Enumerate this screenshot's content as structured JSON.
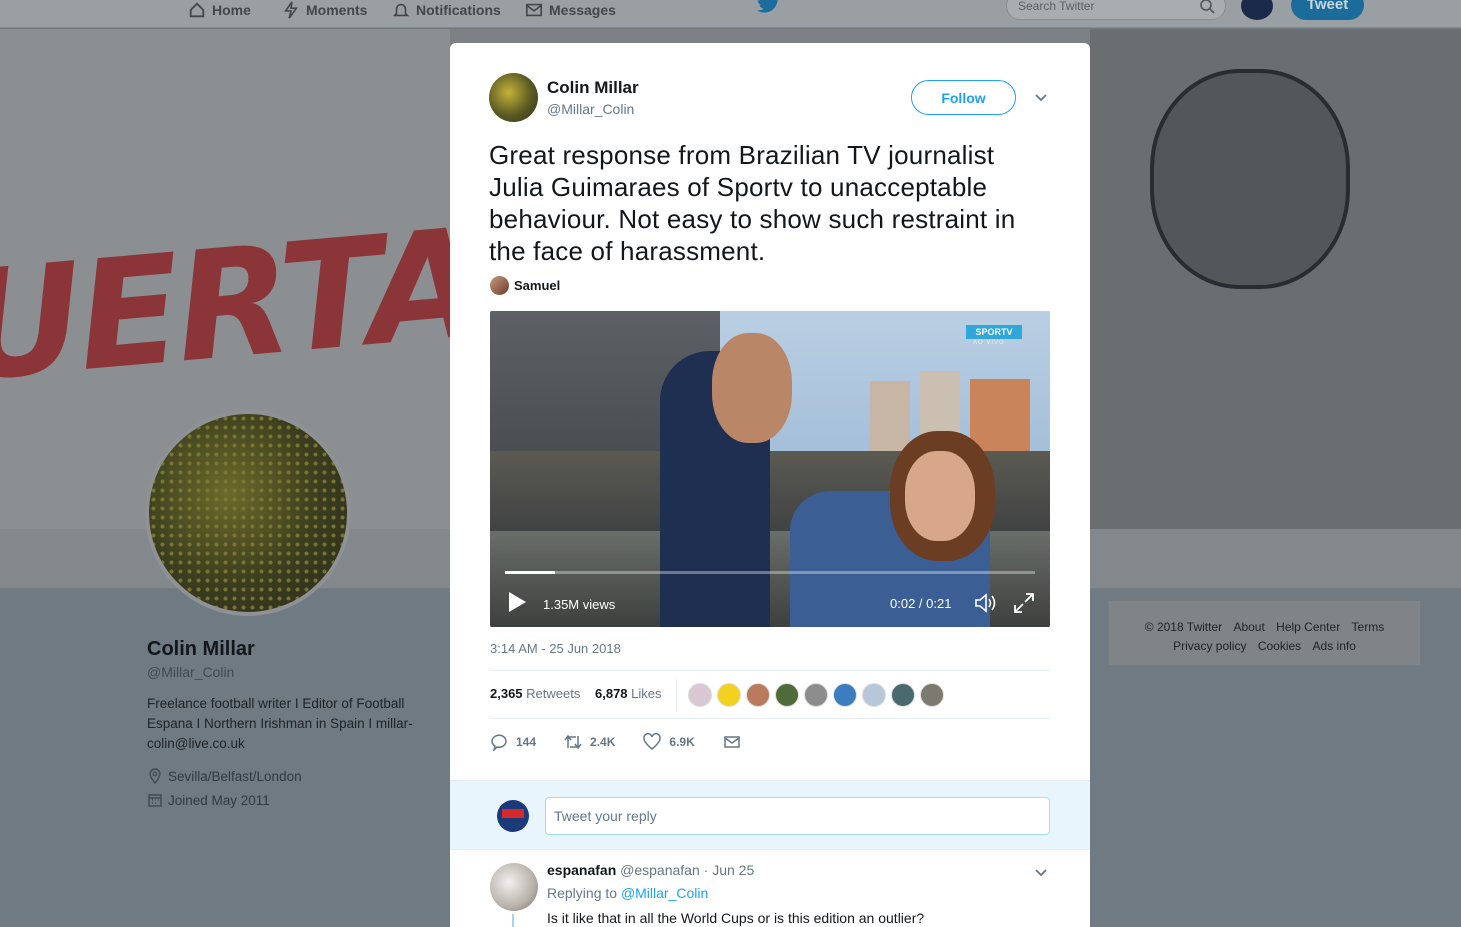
{
  "nav": {
    "items": [
      "Home",
      "Moments",
      "Notifications",
      "Messages"
    ],
    "search_placeholder": "Search Twitter",
    "tweet_button": "Tweet"
  },
  "profile": {
    "name": "Colin Millar",
    "handle": "@Millar_Colin",
    "bio": "Freelance football writer I Editor of Football Espana I Northern Irishman in Spain I millar-colin@live.co.uk",
    "location": "Sevilla/Belfast/London",
    "joined": "Joined May 2011"
  },
  "banner": {
    "text": "UERTA"
  },
  "footer": {
    "row1": [
      "© 2018 Twitter",
      "About",
      "Help Center",
      "Terms"
    ],
    "row2": [
      "Privacy policy",
      "Cookies",
      "Ads info"
    ]
  },
  "tweet": {
    "author_name": "Colin Millar",
    "author_handle": "@Millar_Colin",
    "follow_label": "Follow",
    "text": "Great response from Brazilian TV journalist Julia Guimaraes of Sportv to unacceptable behaviour. Not easy to show such restraint in the face of harassment.",
    "via": "Samuel",
    "video": {
      "views": "1.35M views",
      "time": "0:02 / 0:21",
      "progress": 0.095,
      "channel_logo": "SPORTV",
      "channel_sub": "AO VIVO"
    },
    "timestamp": "3:14 AM - 25 Jun 2018",
    "retweets_count": "2,365",
    "retweets_label": "Retweets",
    "likes_count": "6,878",
    "likes_label": "Likes",
    "liker_colors": [
      "#d9c7d6",
      "#f2d21f",
      "#b97a5e",
      "#4f6b3a",
      "#8d8d8d",
      "#3c7dbf",
      "#b7c7d9",
      "#4a6b6e",
      "#7c7a6e"
    ],
    "actions": {
      "reply_count": "144",
      "retweet_count": "2.4K",
      "like_count": "6.9K"
    },
    "reply_placeholder": "Tweet your reply"
  },
  "reply": {
    "name": "espanafan",
    "handle": "@espanafan",
    "date": "· Jun 25",
    "replying_prefix": "Replying to",
    "replying_to": "@Millar_Colin",
    "text": "Is it like that in all the World Cups or is this edition an outlier?"
  }
}
